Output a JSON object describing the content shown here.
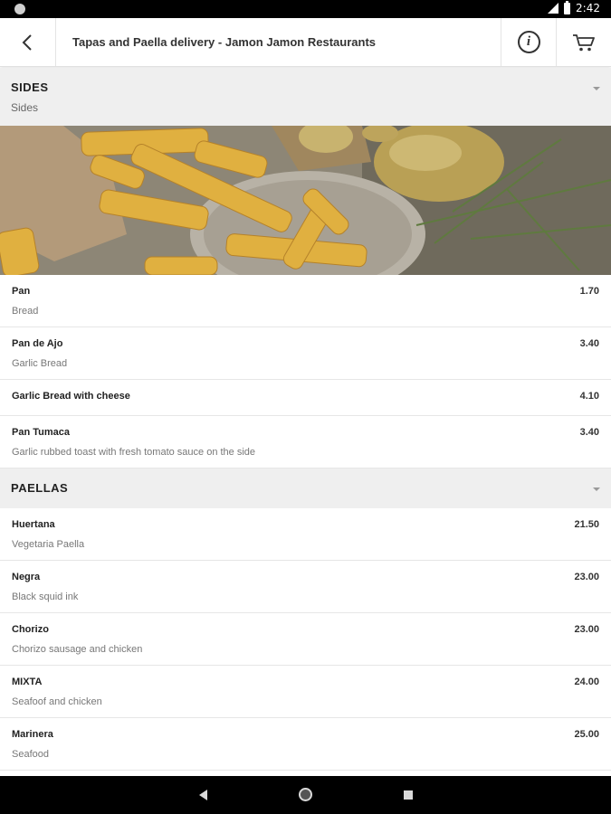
{
  "status_bar": {
    "time": "2:42",
    "icons": [
      "notification-dot-icon",
      "signal-icon",
      "battery-icon"
    ]
  },
  "app_bar": {
    "back_icon": "back-arrow-icon",
    "title": "Tapas and Paella delivery - Jamon Jamon Restaurants",
    "info_icon": "info-icon",
    "info_label": "i",
    "cart_icon": "cart-icon"
  },
  "sections": {
    "sides": {
      "title": "SIDES",
      "subtitle": "Sides",
      "items": [
        {
          "name": "Pan",
          "description": "Bread",
          "price": "1.70"
        },
        {
          "name": "Pan de Ajo",
          "description": "Garlic Bread",
          "price": "3.40"
        },
        {
          "name": "Garlic Bread with cheese",
          "description": "",
          "price": "4.10"
        },
        {
          "name": "Pan Tumaca",
          "description": "Garlic rubbed toast with fresh tomato sauce on the side",
          "price": "3.40"
        }
      ]
    },
    "paellas": {
      "title": "PAELLAS",
      "items": [
        {
          "name": "Huertana",
          "description": "Vegetaria Paella",
          "price": "21.50"
        },
        {
          "name": "Negra",
          "description": "Black squid ink",
          "price": "23.00"
        },
        {
          "name": "Chorizo",
          "description": "Chorizo sausage and chicken",
          "price": "23.00"
        },
        {
          "name": "MIXTA",
          "description": "Seafoof and chicken",
          "price": "24.00"
        },
        {
          "name": "Marinera",
          "description": "Seafood",
          "price": "25.00"
        }
      ]
    }
  },
  "nav_bar": {
    "icons": [
      "nav-back-icon",
      "nav-home-icon",
      "nav-recent-icon"
    ]
  },
  "colors": {
    "section_bg": "#efefef",
    "divider": "#e6e6e6",
    "text": "#222222",
    "muted": "#777777"
  }
}
